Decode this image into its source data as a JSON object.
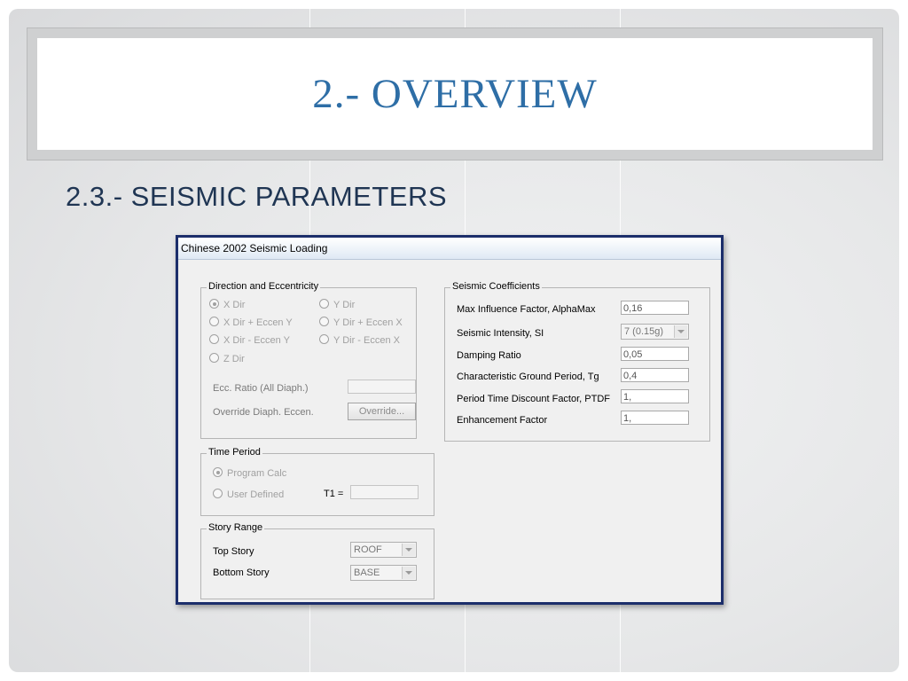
{
  "slide": {
    "title": "2.- OVERVIEW",
    "subtitle": "2.3.- SEISMIC PARAMETERS"
  },
  "dialog": {
    "title": "Chinese 2002 Seismic Loading",
    "direction": {
      "legend": "Direction and Eccentricity",
      "x_dir": "X Dir",
      "y_dir": "Y Dir",
      "x_dir_plus": "X Dir + Eccen Y",
      "y_dir_plus": "Y Dir + Eccen X",
      "x_dir_minus": "X Dir - Eccen Y",
      "y_dir_minus": "Y Dir - Eccen X",
      "z_dir": "Z Dir",
      "ecc_ratio_label": "Ecc. Ratio (All Diaph.)",
      "override_label": "Override Diaph. Eccen.",
      "override_button": "Override..."
    },
    "time_period": {
      "legend": "Time Period",
      "program_calc": "Program Calc",
      "user_defined": "User Defined",
      "t1_label": "T1 ="
    },
    "story_range": {
      "legend": "Story Range",
      "top_story_label": "Top Story",
      "top_story_value": "ROOF",
      "bottom_story_label": "Bottom Story",
      "bottom_story_value": "BASE"
    },
    "coefficients": {
      "legend": "Seismic Coefficients",
      "alpha_max_label": "Max Influence Factor, AlphaMax",
      "alpha_max_value": "0,16",
      "intensity_label": "Seismic Intensity, SI",
      "intensity_value": "7 (0.15g)",
      "damping_label": "Damping Ratio",
      "damping_value": "0,05",
      "tg_label": "Characteristic Ground Period, Tg",
      "tg_value": "0,4",
      "ptdf_label": "Period Time Discount Factor, PTDF",
      "ptdf_value": "1,",
      "enhancement_label": "Enhancement Factor",
      "enhancement_value": "1,"
    }
  }
}
